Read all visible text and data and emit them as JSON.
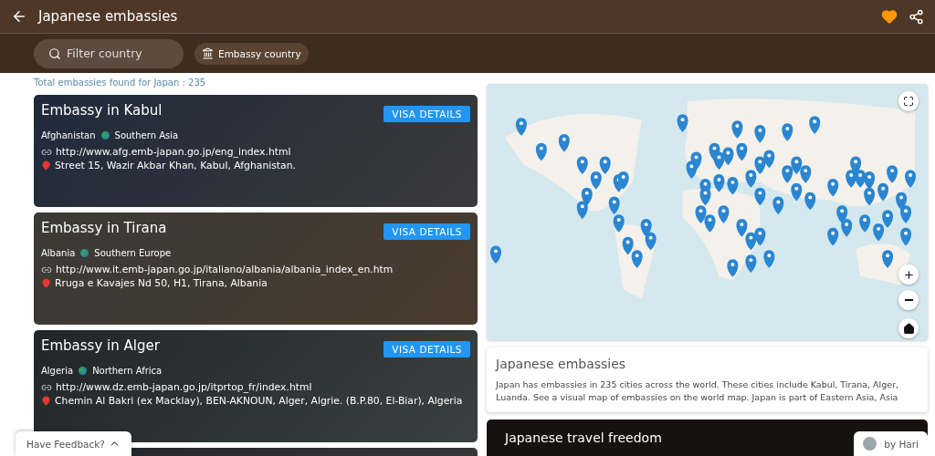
{
  "header": {
    "title": "Japanese embassies",
    "favorite": true
  },
  "filter_bar": {
    "search": {
      "placeholder": "Filter country"
    },
    "chip": {
      "label": "Embassy country"
    }
  },
  "summary": "Total embassies found for  Japan : 235",
  "embassies": [
    {
      "title": "Embassy in Kabul",
      "country": "Afghanistan",
      "region": "Southern Asia",
      "url": "http://www.afg.emb-japan.go.jp/eng_index.html",
      "address": "Street 15, Wazir Akbar Khan, Kabul, Afghanistan.",
      "button": "VISA DETAILS"
    },
    {
      "title": "Embassy in Tirana",
      "country": "Albania",
      "region": "Southern Europe",
      "url": "http://www.it.emb-japan.go.jp/italiano/albania/albania_index_en.htm",
      "address": "Rruga e Kavajes Nd 50, H1, Tirana, Albania",
      "button": "VISA DETAILS"
    },
    {
      "title": "Embassy in Alger",
      "country": "Algeria",
      "region": "Northern Africa",
      "url": "http://www.dz.emb-japan.go.jp/itprtop_fr/index.html",
      "address": "Chemin Al Bakri (ex Macklay), BEN-AKNOUN, Alger, Algrie. (B.P.80, El-Biar), Algeria",
      "button": "VISA DETAILS"
    }
  ],
  "info_card": {
    "title": "Japanese embassies",
    "text": "Japan has embassies in 235 cities across the world. These cities include Kabul, Tirana, Alger, Luanda. See a visual map of embassies on the world map. Japan is part of Eastern Asia, Asia"
  },
  "travel_card": {
    "title": "Japanese travel freedom"
  },
  "feedback": {
    "label": "Have Feedback?"
  },
  "author_badge": {
    "label": "by Hari"
  }
}
